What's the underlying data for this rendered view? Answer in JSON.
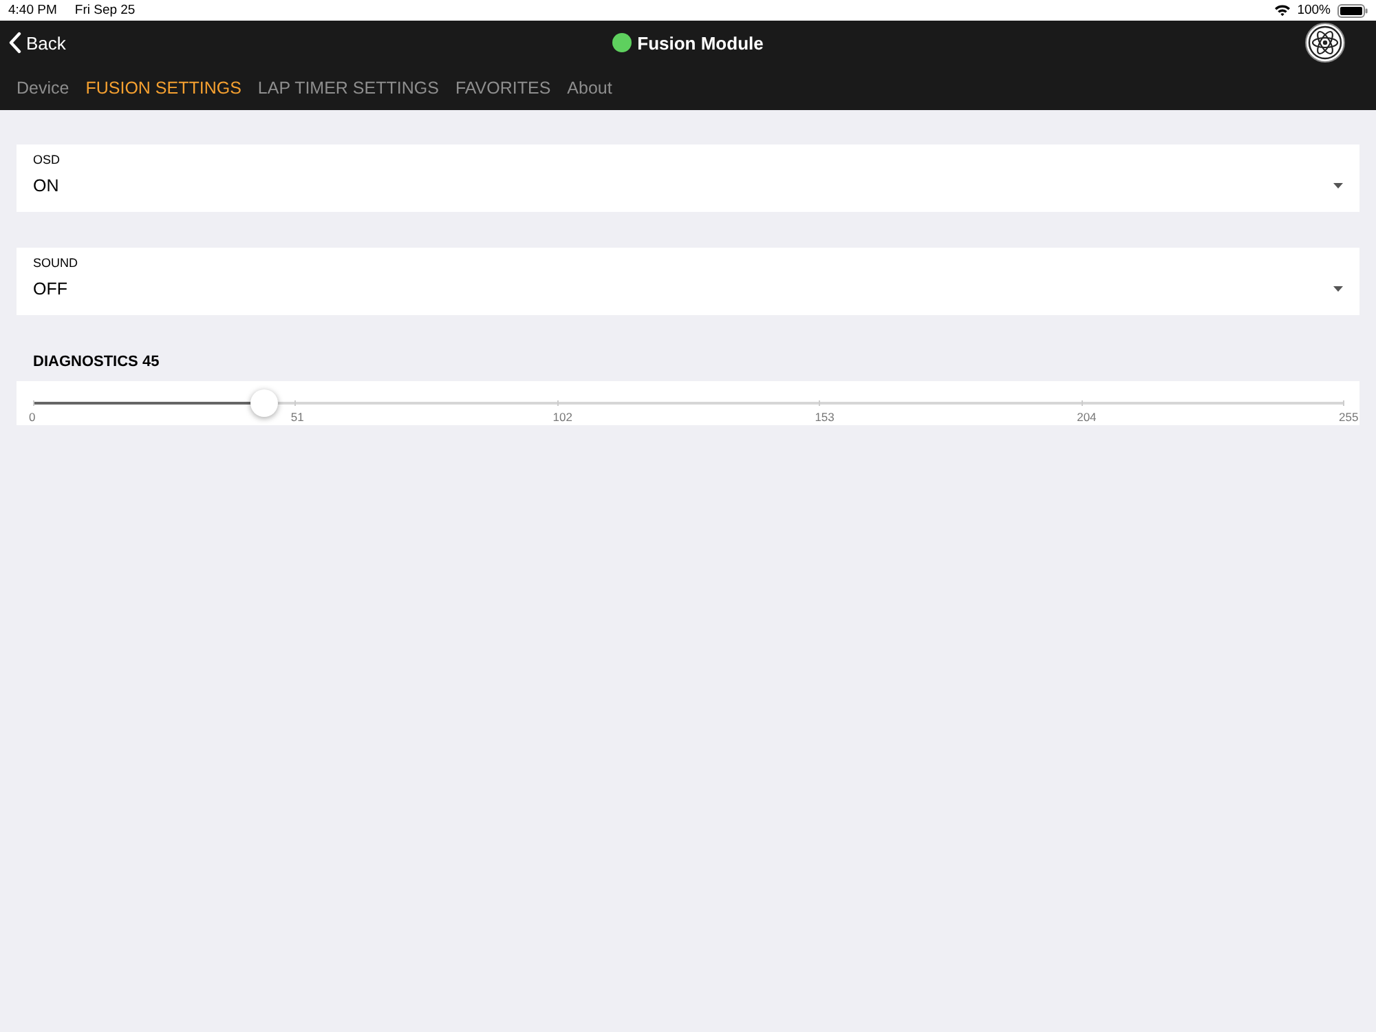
{
  "status_bar": {
    "time": "4:40 PM",
    "date": "Fri Sep 25",
    "battery": "100%"
  },
  "nav": {
    "back": "Back",
    "title": "Fusion Module",
    "connected": true
  },
  "tabs": [
    {
      "label": "Device",
      "selected": false
    },
    {
      "label": "FUSION SETTINGS",
      "selected": true
    },
    {
      "label": "LAP TIMER SETTINGS",
      "selected": false
    },
    {
      "label": "FAVORITES",
      "selected": false
    },
    {
      "label": "About",
      "selected": false
    }
  ],
  "settings": [
    {
      "label": "OSD",
      "value": "ON"
    },
    {
      "label": "SOUND",
      "value": "OFF"
    }
  ],
  "slider": {
    "label": "DIAGNOSTICS 45",
    "level": 0.176,
    "ticks": [
      "0",
      "51",
      "102",
      "153",
      "204",
      "255"
    ]
  }
}
